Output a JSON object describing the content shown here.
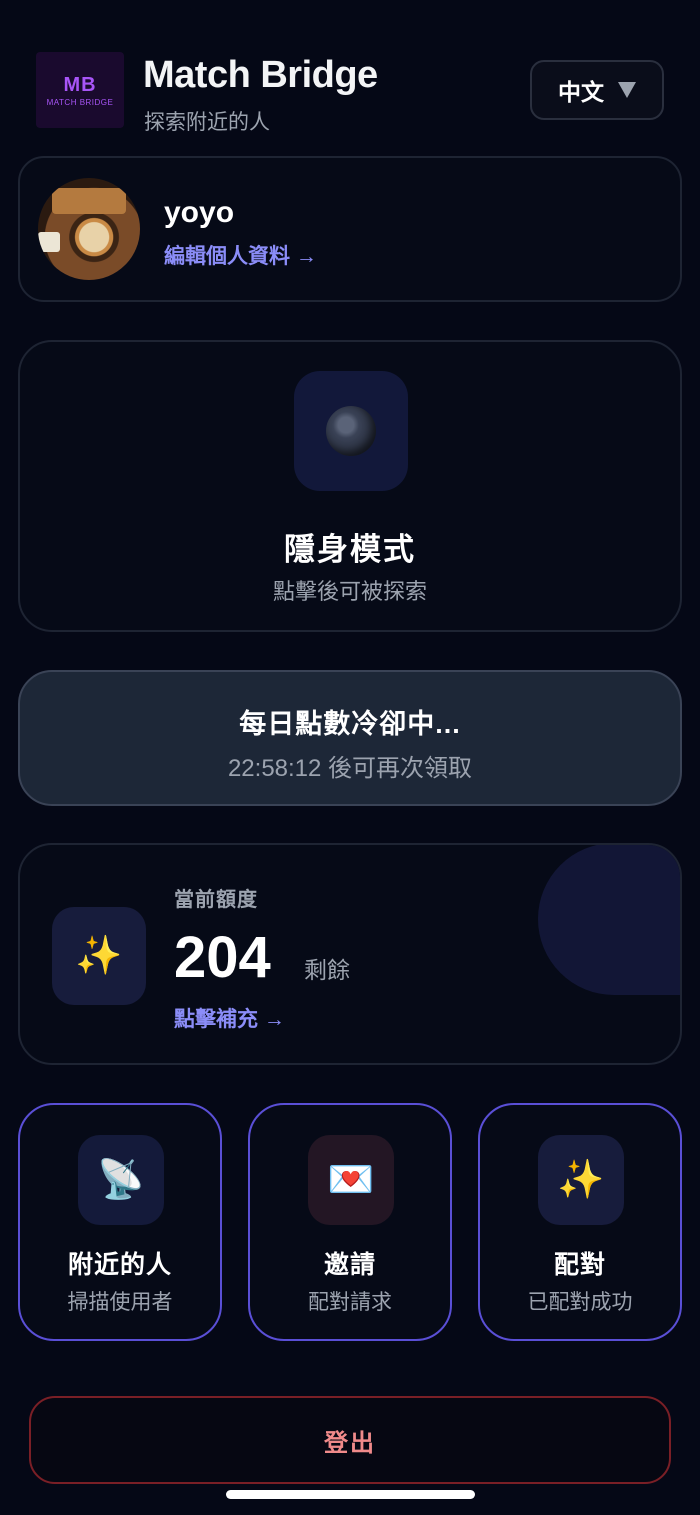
{
  "header": {
    "logo_mark": "MB",
    "logo_sub": "MATCH BRIDGE",
    "title": "Match Bridge",
    "subtitle": "探索附近的人",
    "language": "中文"
  },
  "profile": {
    "name": "yoyo",
    "edit_link": "編輯個人資料 →"
  },
  "stealth": {
    "title": "隱身模式",
    "subtitle": "點擊後可被探索",
    "icon": "moon-icon"
  },
  "cooldown": {
    "title": "每日點數冷卻中...",
    "subtitle": "22:58:12 後可再次領取"
  },
  "credits": {
    "label": "當前額度",
    "value": "204",
    "unit": "剩餘",
    "topup_link": "點擊補充 →",
    "icon": "sparkles-icon"
  },
  "features": [
    {
      "title": "附近的人",
      "subtitle": "掃描使用者",
      "icon": "satellite-dish-icon",
      "glyph": "📡"
    },
    {
      "title": "邀請",
      "subtitle": "配對請求",
      "icon": "love-letter-icon",
      "glyph": "💌"
    },
    {
      "title": "配對",
      "subtitle": "已配對成功",
      "icon": "sparkles-icon",
      "glyph": "✨"
    }
  ],
  "logout": {
    "label": "登出"
  },
  "colors": {
    "background": "#050816",
    "accent": "#8b8df8",
    "tile_border": "#5a4fd6",
    "logout": "#f08a8a"
  }
}
